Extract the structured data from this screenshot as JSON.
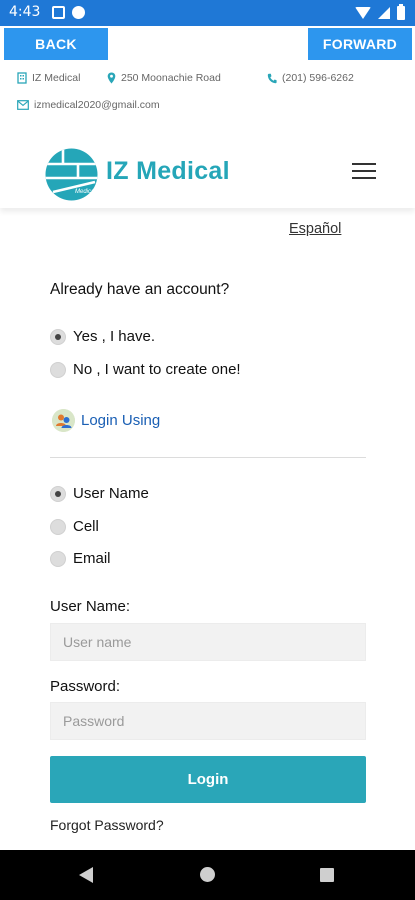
{
  "status_bar": {
    "time": "4:43"
  },
  "nav": {
    "back_label": "BACK",
    "forward_label": "FORWARD"
  },
  "contact": {
    "name": "IZ Medical",
    "address": "250 Moonachie Road",
    "phone": "(201) 596-6262",
    "email": "izmedical2020@gmail.com"
  },
  "header": {
    "logo_text": "IZ Medical",
    "logo_small_text": "Medical"
  },
  "language_link": "Español",
  "account": {
    "question": "Already have an account?",
    "options": [
      {
        "label": "Yes , I have.",
        "checked": true
      },
      {
        "label": "No , I want to create one!",
        "checked": false
      }
    ]
  },
  "login_using": "Login Using",
  "login_type": {
    "options": [
      {
        "label": "User Name",
        "checked": true
      },
      {
        "label": "Cell",
        "checked": false
      },
      {
        "label": "Email",
        "checked": false
      }
    ]
  },
  "form": {
    "username_label": "User Name:",
    "username_placeholder": "User name",
    "password_label": "Password:",
    "password_placeholder": "Password",
    "login_button": "Login",
    "forgot_password": "Forgot Password?"
  },
  "colors": {
    "status_bar": "#1f78d6",
    "nav_button": "#2d96ee",
    "brand_teal": "#2aa6b8",
    "link_blue": "#1a5fb4"
  }
}
